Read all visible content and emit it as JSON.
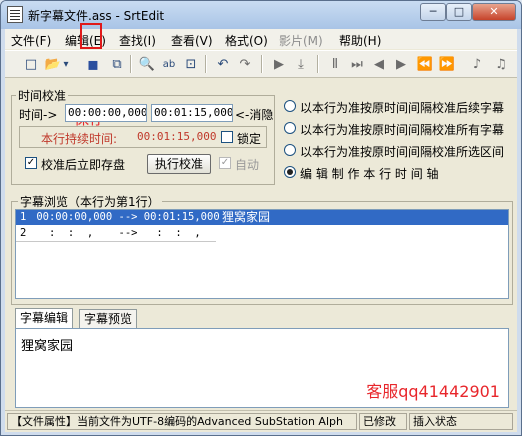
{
  "window": {
    "title": "新字幕文件.ass - SrtEdit"
  },
  "titlebar_buttons": {
    "minimize": "─",
    "maximize": "□",
    "close": "✕"
  },
  "menu": [
    "文件(F)",
    "编辑(E)",
    "查找(I)",
    "查看(V)",
    "格式(O)",
    "影片(M)",
    "帮助(H)"
  ],
  "toolbar_icons": {
    "new": "□",
    "open": "📂",
    "open_arrow": "▾",
    "save": "▪",
    "saveas": "⧉",
    "find": "🔍",
    "replace": "ab",
    "goto": "⊡",
    "undo": "↶",
    "redo": "↷",
    "play": "▶",
    "jump": "⤓",
    "pause": "Ⅱ",
    "next_frame": "⏭",
    "prev": "◀",
    "next": "▶",
    "rewind": "⏪",
    "forward": "⏩",
    "vol_down": "♪",
    "vol_up": "♫"
  },
  "annotation": {
    "save_label": "保存",
    "service": "客服qq41442901"
  },
  "calibration": {
    "legend": "时间校准",
    "time_prefix": "时间->",
    "start": "00:00:00,000",
    "end": "00:01:15,000",
    "hide_label": "<-消隐",
    "duration_label": "本行持续时间:",
    "duration_value": "00:01:15,000",
    "lock_label": "锁定",
    "save_after_label": "校准后立即存盘",
    "save_after_checked": "✓",
    "execute_button": "执行校准",
    "auto_label": "自动",
    "auto_checked": "✓"
  },
  "options": [
    {
      "label": "以本行为准按原时间间隔校准后续字幕",
      "selected": false
    },
    {
      "label": "以本行为准按原时间间隔校准所有字幕",
      "selected": false
    },
    {
      "label": "以本行为准按原时间间隔校准所选区间",
      "selected": false
    },
    {
      "label": "编 辑 制 作 本 行 时 间 轴",
      "selected": true
    }
  ],
  "browse": {
    "legend": "字幕浏览（本行为第1行）",
    "rows": [
      {
        "num": "1",
        "time": " 00:00:00,000 --> 00:01:15,000",
        "text": "狸窝家园"
      },
      {
        "num": "2",
        "time": "   :  :  ,    -->   :  :  ,",
        "text": ""
      }
    ]
  },
  "tabs": [
    "字幕编辑",
    "字幕预览"
  ],
  "editor": {
    "text": "狸窝家园"
  },
  "status": {
    "file_info": "【文件属性】当前文件为UTF-8编码的Advanced SubStation Alph",
    "modified": "已修改",
    "mode": "插入状态"
  }
}
